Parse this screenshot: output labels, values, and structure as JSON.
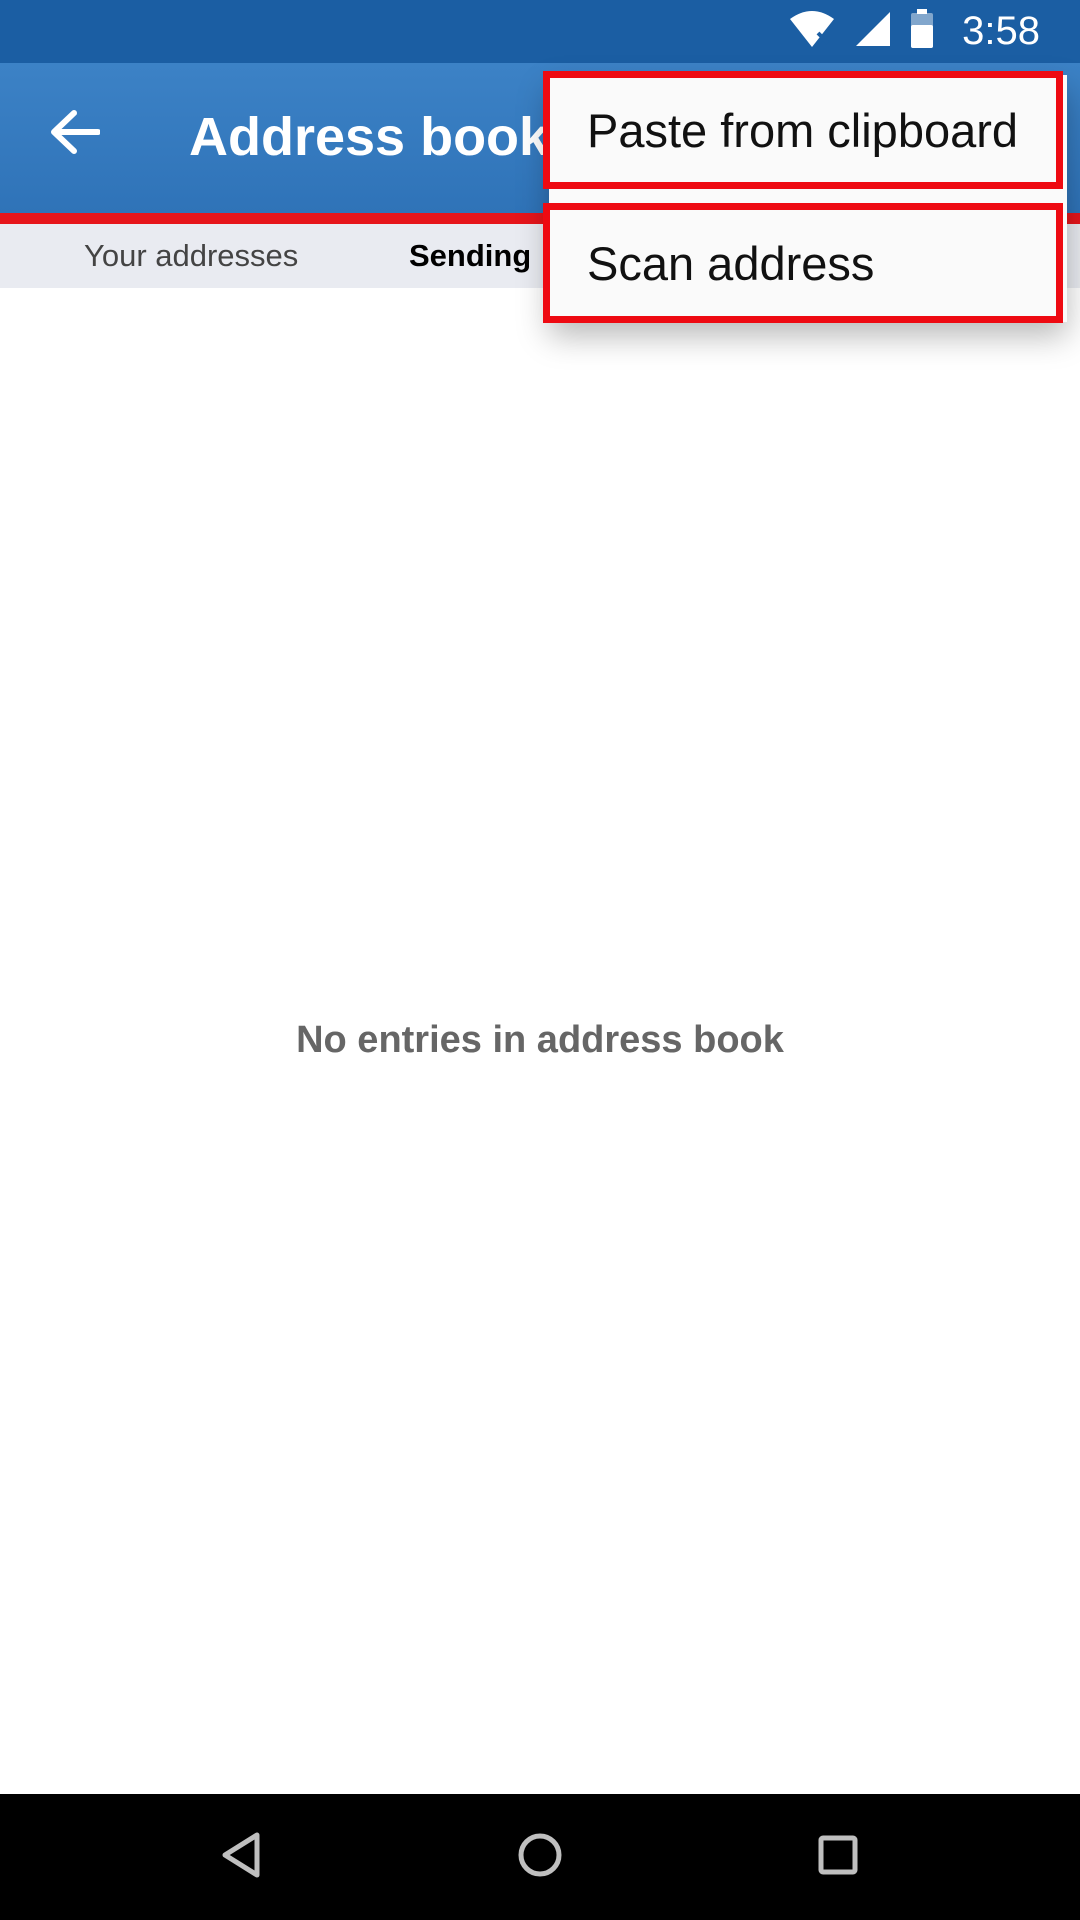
{
  "status_bar": {
    "time": "3:58",
    "icons": [
      "wifi-icon",
      "signal-icon",
      "battery-icon"
    ]
  },
  "app_bar": {
    "title": "Address book",
    "back_icon": "arrow-left-icon"
  },
  "tabs": [
    {
      "label": "Your addresses",
      "selected": false
    },
    {
      "label": "Sending a",
      "selected": true
    }
  ],
  "empty_state": {
    "message": "No entries in address book"
  },
  "menu": {
    "items": [
      {
        "label": "Paste from clipboard"
      },
      {
        "label": "Scan address"
      }
    ]
  },
  "nav_bar": {
    "icons": [
      "back-triangle-icon",
      "home-circle-icon",
      "recents-square-icon"
    ]
  },
  "colors": {
    "status_bar": "#1b5ea3",
    "app_bar": "#3278bd",
    "highlight": "#ee0a12"
  }
}
